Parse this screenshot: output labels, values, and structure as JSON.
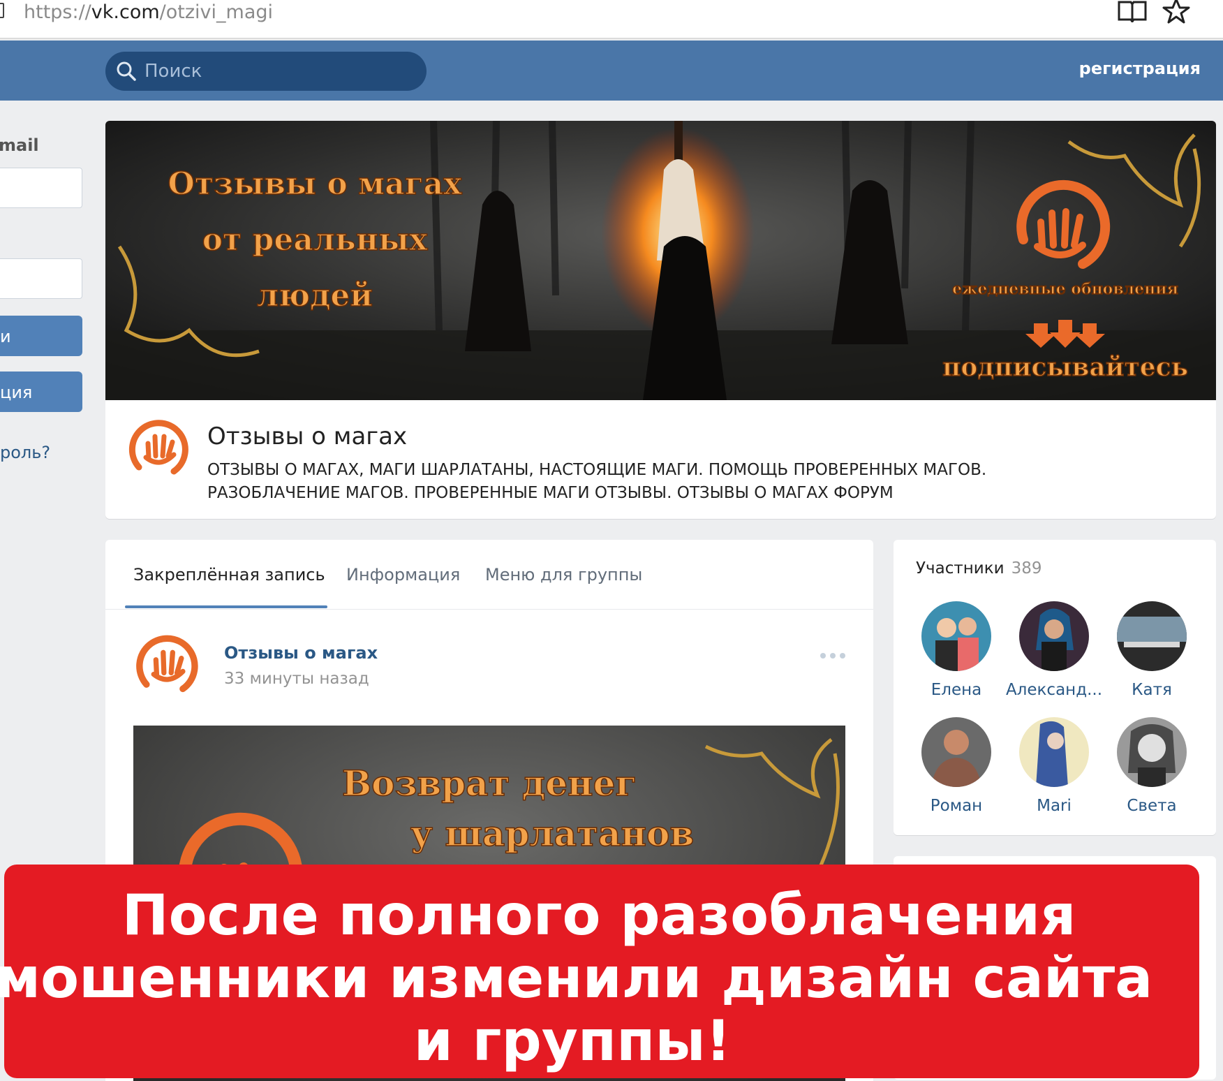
{
  "browser": {
    "url_scheme": "https://",
    "url_host": "vk.com",
    "url_path": "/otzivi_magi"
  },
  "header": {
    "search_placeholder": "Поиск",
    "register_label": "регистрация",
    "brand_color": "#4a76a8"
  },
  "login": {
    "email_label_fragment": "mail",
    "login_button_fragment": "и",
    "register_button_fragment": "ция",
    "forgot_fragment": "роль?"
  },
  "cover": {
    "headline": [
      "Отзывы о магах",
      "от реальных",
      "людей"
    ],
    "daily_updates": "ежедневные обновления",
    "subscribe": "подписывайтесь"
  },
  "group": {
    "title": "Отзывы о магах",
    "status_line1": "ОТЗЫВЫ О МАГАХ, МАГИ ШАРЛАТАНЫ, НАСТОЯЩИЕ МАГИ. ПОМОЩЬ ПРОВЕРЕННЫХ МАГОВ.",
    "status_line2": "РАЗОБЛАЧЕНИЕ МАГОВ. ПРОВЕРЕННЫЕ МАГИ ОТЗЫВЫ. ОТЗЫВЫ О МАГАХ ФОРУМ"
  },
  "tabs": [
    {
      "label": "Закреплённая запись"
    },
    {
      "label": "Информация"
    },
    {
      "label": "Меню для группы"
    }
  ],
  "post": {
    "author": "Отзывы о магах",
    "time": "33 минуты назад",
    "image_line1": "Возврат денег",
    "image_line2": "у шарлатанов"
  },
  "members": {
    "title": "Участники",
    "count": "389",
    "list": [
      {
        "name": "Елена",
        "color": "#3d8fb0"
      },
      {
        "name": "Александ...",
        "color": "#3a2a3a"
      },
      {
        "name": "Катя",
        "color": "#7c96a8"
      },
      {
        "name": "Роман",
        "color": "#8a5a48"
      },
      {
        "name": "Mari",
        "color": "#3a5aa0"
      },
      {
        "name": "Света",
        "color": "#9a9a9a"
      }
    ]
  },
  "banner": {
    "line1": "После полного разоблачения",
    "line2": "мошенники изменили дизайн сайта",
    "line3": "и группы!",
    "color": "#e41b23"
  }
}
